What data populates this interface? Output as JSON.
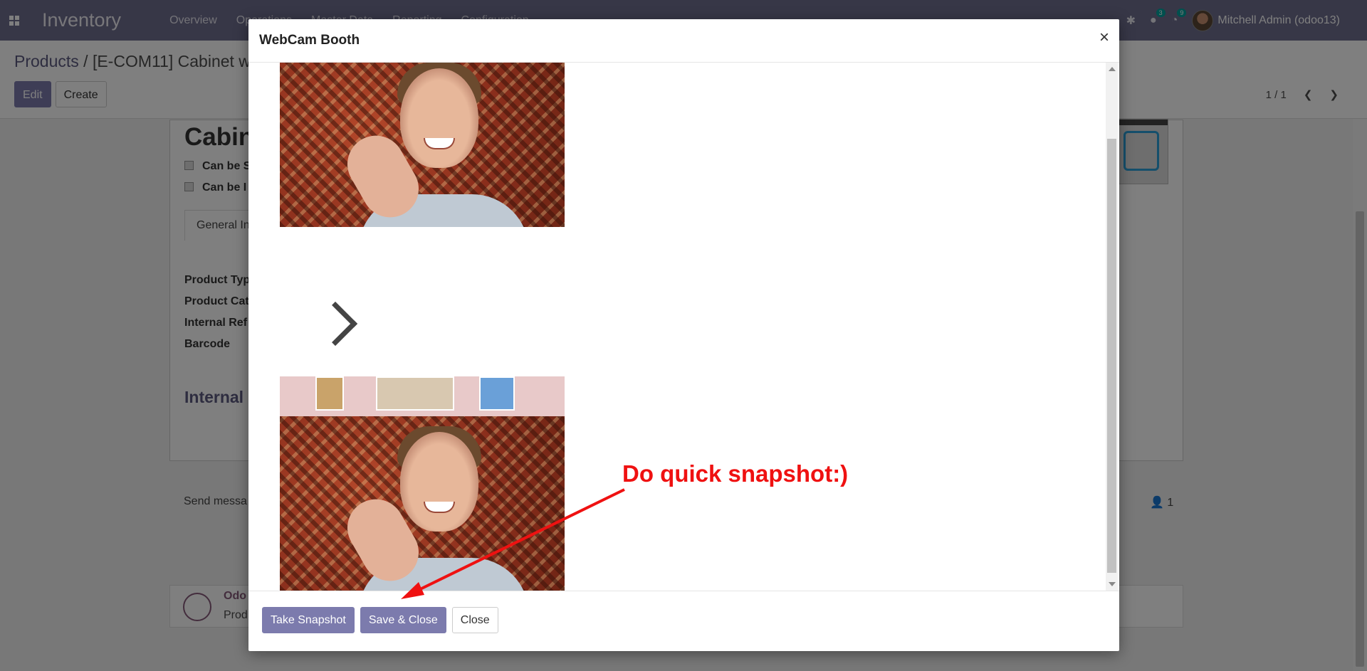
{
  "navbar": {
    "app_name": "Inventory",
    "menu": [
      "Overview",
      "Operations",
      "Master Data",
      "Reporting",
      "Configuration"
    ],
    "messages_count": "3",
    "activities_count": "9",
    "user": "Mitchell Admin (odoo13)"
  },
  "breadcrumb": {
    "parent": "Products",
    "separator": "/",
    "current": "[E-COM11] Cabinet w"
  },
  "control_panel": {
    "edit_label": "Edit",
    "create_label": "Create",
    "pager": "1 / 1"
  },
  "form": {
    "title": "Cabin",
    "can_be_sold": "Can be S",
    "can_be_purchased": "Can be I",
    "tab_general": "General In",
    "fields": [
      "Product Typ",
      "Product Cat",
      "Internal Ref",
      "Barcode"
    ],
    "section": "Internal"
  },
  "chatter": {
    "send_message": "Send messa",
    "followers": "1",
    "author": "Odo",
    "message": "Prod"
  },
  "modal": {
    "title": "WebCam Booth",
    "close_symbol": "×",
    "annotation": "Do quick snapshot:)",
    "annotation_color": "#ef1111",
    "buttons": {
      "take_snapshot": "Take Snapshot",
      "save_close": "Save & Close",
      "close": "Close"
    }
  },
  "colors": {
    "navbar": "#6f6e8f",
    "primary_button": "#7c7bad"
  }
}
